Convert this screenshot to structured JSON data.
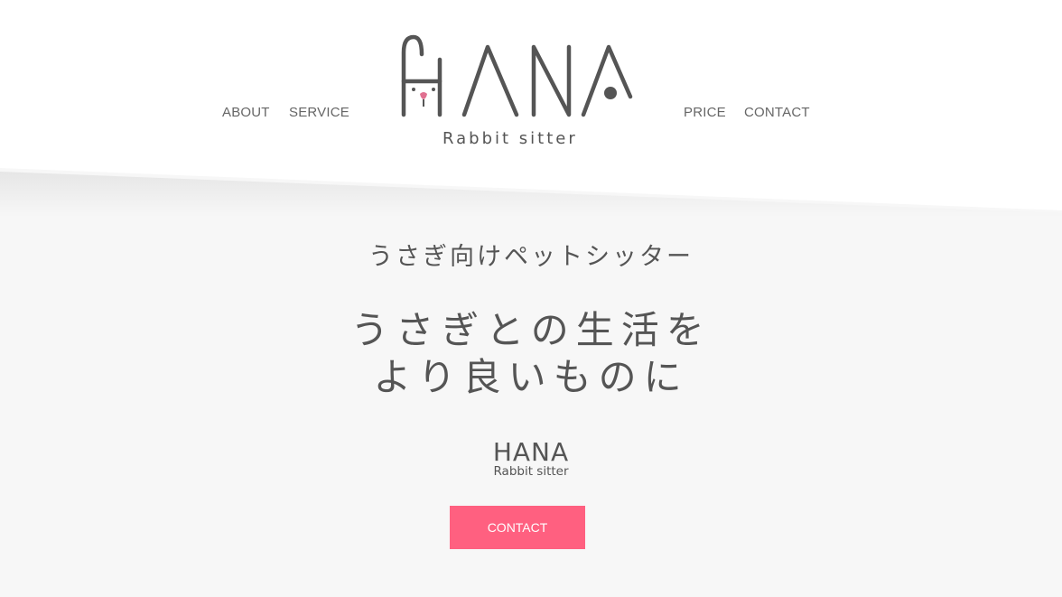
{
  "nav": {
    "left": [
      {
        "label": "ABOUT"
      },
      {
        "label": "SERVICE"
      }
    ],
    "right": [
      {
        "label": "PRICE"
      },
      {
        "label": "CONTACT"
      }
    ]
  },
  "logo": {
    "text": "HANA",
    "subtitle": "Rabbit sitter",
    "icon": "rabbit-face-icon"
  },
  "hero": {
    "subtitle": "うさぎ向けペットシッター",
    "title_line1": "うさぎとの生活を",
    "title_line2": "より良いものに",
    "brand_name": "HANA",
    "brand_sub": "Rabbit sitter",
    "cta_label": "CONTACT"
  },
  "colors": {
    "header_bg": "#ffffff",
    "page_bg": "#f7f7f7",
    "text": "#555555",
    "accent": "#ff6080",
    "nose": "#e07090"
  }
}
